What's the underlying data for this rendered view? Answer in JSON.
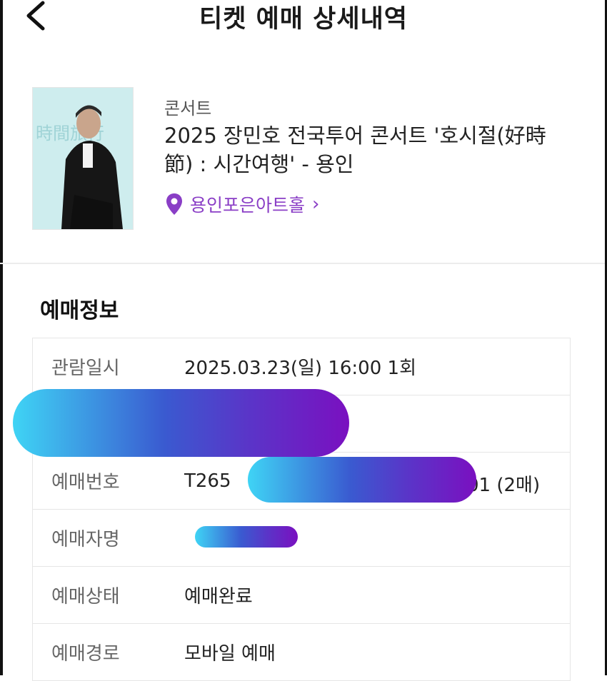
{
  "header": {
    "title": "티켓 예매 상세내역",
    "back_icon": "chevron-left-icon"
  },
  "product": {
    "category": "콘서트",
    "title": "2025 장민호 전국투어 콘서트 '호시절(好時節) : 시간여행' - 용인",
    "venue": "용인포은아트홀",
    "venue_icon": "location-pin-icon",
    "venue_color": "#8a3ec6"
  },
  "booking_info": {
    "section_title": "예매정보",
    "rows": [
      {
        "label": "관람일시",
        "value": "2025.03.23(일) 16:00 1회"
      },
      {
        "label": "",
        "value": ""
      },
      {
        "label": "예매번호",
        "value_prefix": "T265",
        "value_suffix": "01 (2매)"
      },
      {
        "label": "예매자명",
        "value": ""
      },
      {
        "label": "예매상태",
        "value": "예매완료"
      },
      {
        "label": "예매경로",
        "value": "모바일 예매"
      }
    ]
  },
  "colors": {
    "redaction_start": "#3fd4f5",
    "redaction_end": "#7a10c0"
  }
}
